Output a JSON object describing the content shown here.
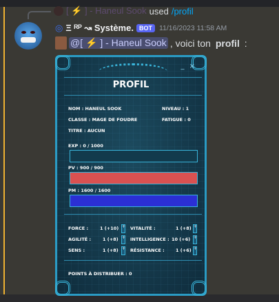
{
  "reply": {
    "user": "[ ⚡ ] - Haneul Sook",
    "action": "used",
    "command": "/profil"
  },
  "message": {
    "author": "Ξ ᴿᴾ ↝ Système.",
    "badge": "BOT",
    "timestamp": "11/16/2023 11:58 AM",
    "mention": "@[ ⚡ ] - Haneul Sook",
    "text": ", voici ton ",
    "bold": "profil",
    "end": " :"
  },
  "colors": {
    "accent": "#f0b232",
    "pv": "#d95151",
    "pm": "#2b2fd4",
    "frame": "#2a9bc4"
  },
  "card": {
    "title": "PROFIL",
    "controls": "_ ×",
    "nom": "NOM : HANEUL SOOK",
    "niveau": "NIVEAU : 1",
    "classe": "CLASSE : MAGE DE FOUDRE",
    "fatigue": "FATIGUE : 0",
    "titre": "TITRE : AUCUN",
    "exp": {
      "label": "EXP : 0 / 1000",
      "fill": 0
    },
    "pv": {
      "label": "PV : 900 / 900",
      "fill": 1
    },
    "pm": {
      "label": "PM : 1600 / 1600",
      "fill": 1
    },
    "stats": [
      {
        "name": "FORCE :",
        "value": "1 (+10)"
      },
      {
        "name": "VITALITÉ :",
        "value": "1 (+8)"
      },
      {
        "name": "AGILITÉ :",
        "value": "1 (+8)"
      },
      {
        "name": "INTELLIGENCE :",
        "value": "10 (+6)"
      },
      {
        "name": "SENS :",
        "value": "1 (+8)"
      },
      {
        "name": "RÉSISTANCE :",
        "value": "1 (+6)"
      }
    ],
    "plus": "+",
    "points": "POINTS À DISTRIBUER : 0"
  }
}
